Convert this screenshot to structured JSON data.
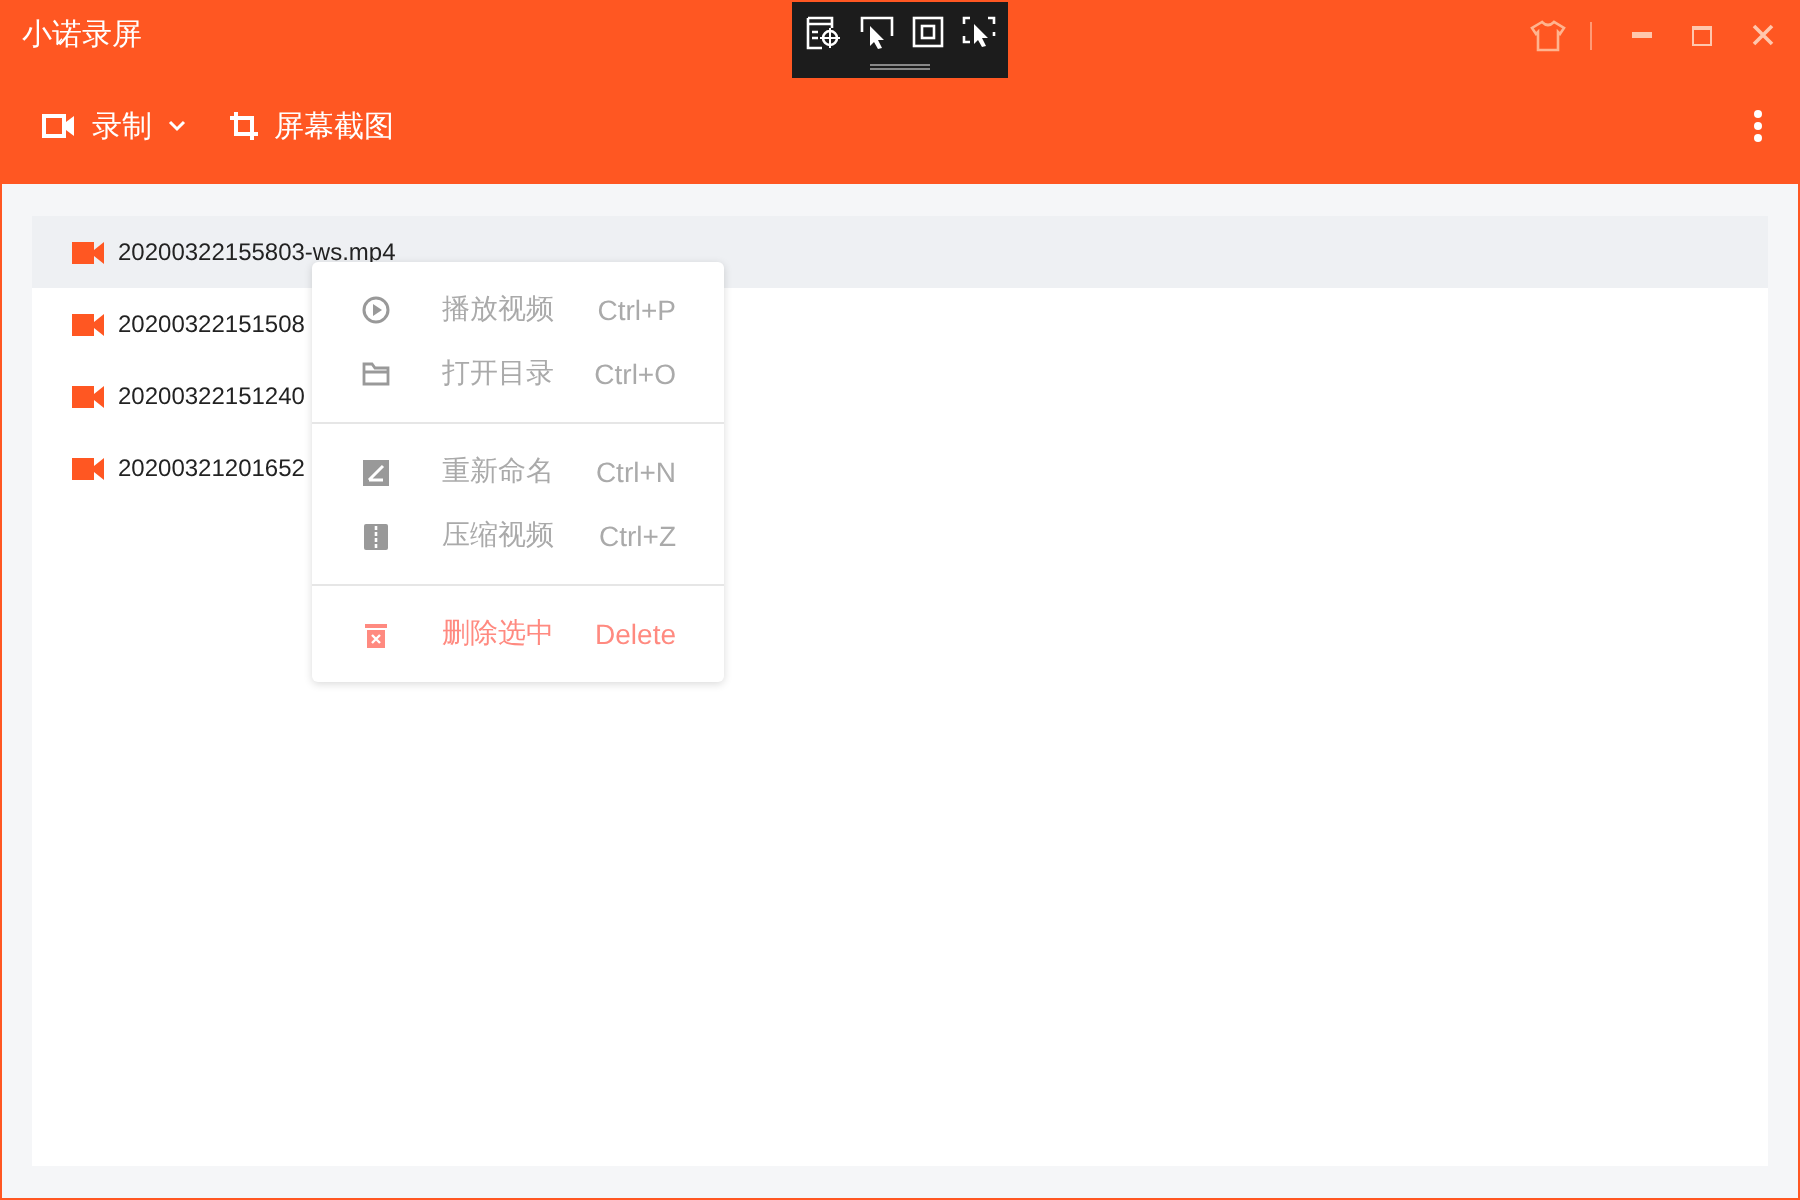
{
  "window": {
    "title": "小诺录屏"
  },
  "toolbar": {
    "record_label": "录制",
    "screenshot_label": "屏幕截图"
  },
  "files": [
    {
      "name": "20200322155803-ws.mp4",
      "selected": true
    },
    {
      "name": "20200322151508",
      "selected": false
    },
    {
      "name": "20200322151240",
      "selected": false
    },
    {
      "name": "20200321201652",
      "selected": false
    }
  ],
  "context_menu": {
    "groups": [
      [
        {
          "kind": "play",
          "label": "播放视频",
          "shortcut": "Ctrl+P"
        },
        {
          "kind": "folder",
          "label": "打开目录",
          "shortcut": "Ctrl+O"
        }
      ],
      [
        {
          "kind": "rename",
          "label": "重新命名",
          "shortcut": "Ctrl+N"
        },
        {
          "kind": "compress",
          "label": "压缩视频",
          "shortcut": "Ctrl+Z"
        }
      ],
      [
        {
          "kind": "delete",
          "label": "删除选中",
          "shortcut": "Delete"
        }
      ]
    ]
  }
}
